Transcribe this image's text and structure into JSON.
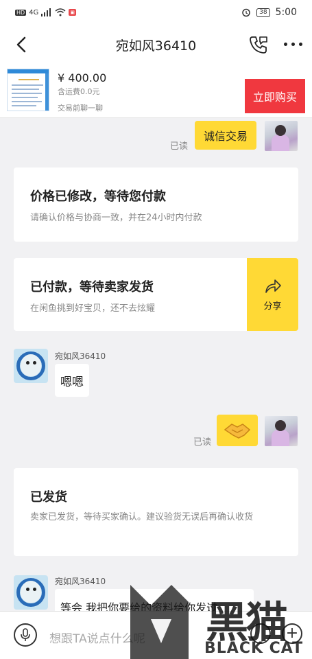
{
  "status_bar": {
    "network": "HD",
    "signal_label": "4G",
    "time": "5:00",
    "battery": "38"
  },
  "nav": {
    "title": "宛如风36410"
  },
  "product": {
    "price": "¥ 400.00",
    "shipping": "含运费0.0元",
    "chat_before": "交易前聊一聊",
    "buy_label": "立即购买"
  },
  "messages": {
    "me1": {
      "text": "诚信交易",
      "read": "已读"
    },
    "card_price": {
      "title": "价格已修改，等待您付款",
      "subtitle": "请确认价格与协商一致，并在24小时内付款"
    },
    "card_paid": {
      "title": "已付款，等待卖家发货",
      "subtitle": "在闲鱼挑到好宝贝，还不去炫耀",
      "share_label": "分享"
    },
    "other1": {
      "sender": "宛如风36410",
      "text": "嗯嗯"
    },
    "me2": {
      "read": "已读"
    },
    "card_shipped": {
      "title": "已发货",
      "subtitle": "卖家已发货，等待买家确认。建议验货无误后再确认收货"
    },
    "other2": {
      "sender": "宛如风36410",
      "text": "等会 我把你要给的资料给你发过"
    }
  },
  "input": {
    "placeholder": "想跟TA说点什么呢"
  },
  "watermark": {
    "cn": "黑猫",
    "en": "BLACK CAT"
  },
  "colors": {
    "accent_yellow": "#ffd935",
    "buy_red": "#f0383f",
    "background": "#f1f1f3"
  }
}
